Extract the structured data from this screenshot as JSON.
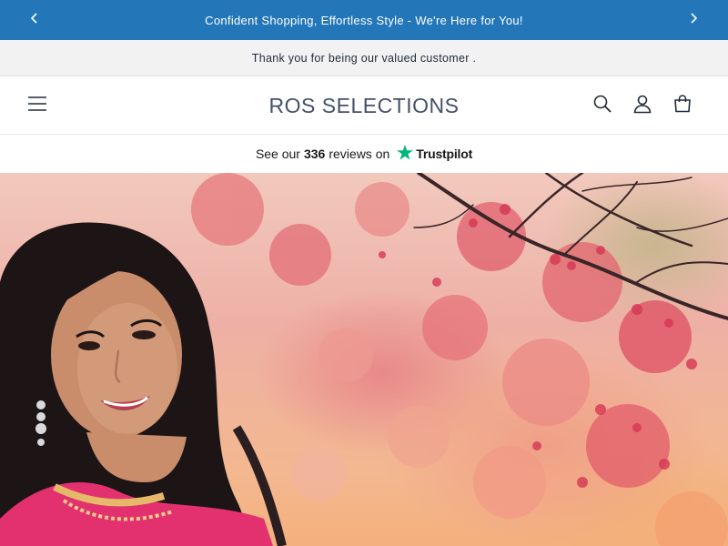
{
  "announcement": {
    "message": "Confident Shopping, Effortless Style - We're Here for You!",
    "prev_icon": "chevron-left-icon",
    "next_icon": "chevron-right-icon",
    "background": "#2377b8"
  },
  "secondary_bar": {
    "message": "Thank you for being our valued customer ."
  },
  "header": {
    "logo": "ROS SELECTIONS",
    "icons": [
      "menu-icon",
      "search-icon",
      "account-icon",
      "cart-icon"
    ]
  },
  "trustpilot": {
    "prefix": "See our",
    "count": "336",
    "suffix": "reviews on",
    "brand": "Trustpilot",
    "star_color": "#00b67a"
  },
  "hero": {
    "image": "woman-portrait-with-autumn-blossom-tree"
  }
}
